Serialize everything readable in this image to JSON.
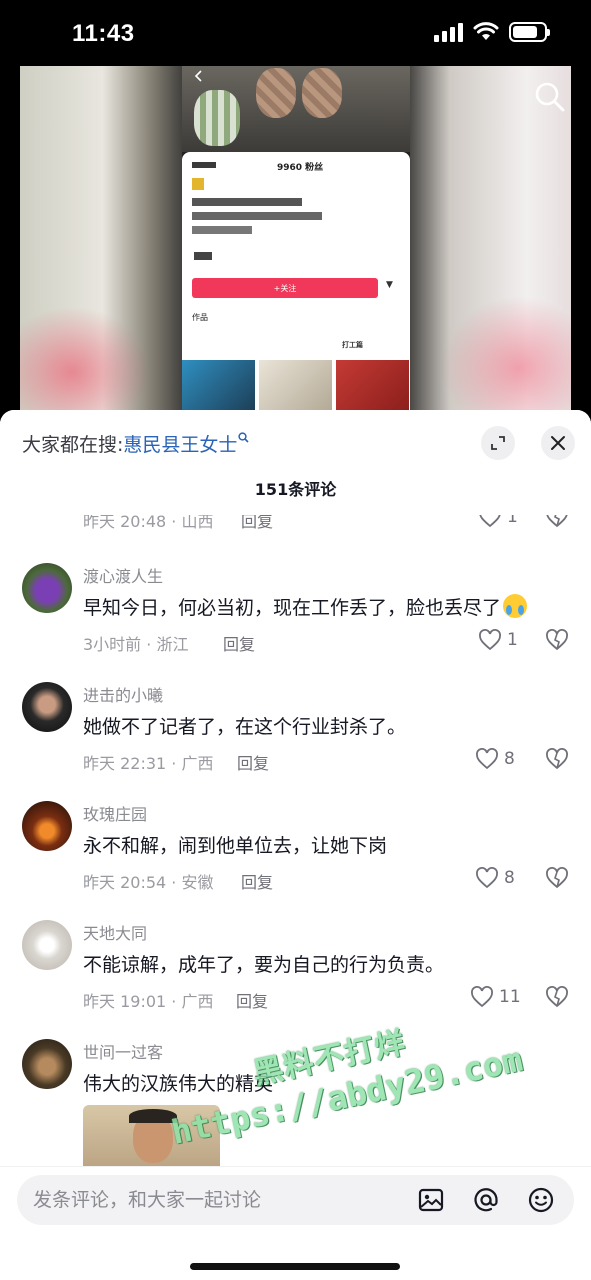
{
  "status_bar": {
    "time": "11:43"
  },
  "comment_panel": {
    "search_prefix": "大家都在搜:",
    "search_term": "惠民县王女士",
    "count_label": "151条评论"
  },
  "video_overlay": {
    "follower_stat": "9960 粉丝",
    "follow_label": "+关注",
    "works_label": "作品",
    "tab_label": "打工篇"
  },
  "partial_comment": {
    "meta": "昨天 20:48 · 山西",
    "reply": "回复",
    "likes": "1"
  },
  "comments": [
    {
      "name": "渡心渡人生",
      "text": "早知今日，何必当初，现在工作丢了，脸也丢尽了",
      "meta": "3小时前 · 浙江",
      "reply": "回复",
      "likes": "1"
    },
    {
      "name": "进击的小曦",
      "text": "她做不了记者了，在这个行业封杀了。",
      "meta": "昨天 22:31 · 广西",
      "reply": "回复",
      "likes": "8"
    },
    {
      "name": "玫瑰庄园",
      "text": "永不和解，闹到他单位去，让她下岗",
      "meta": "昨天 20:54 · 安徽",
      "reply": "回复",
      "likes": "8"
    },
    {
      "name": "天地大同",
      "text": "不能谅解，成年了，要为自己的行为负责。",
      "meta": "昨天 19:01 · 广西",
      "reply": "回复",
      "likes": "11"
    },
    {
      "name": "世间一过客",
      "text": "伟大的汉族伟大的精英"
    }
  ],
  "input_bar": {
    "placeholder": "发条评论，和大家一起讨论"
  },
  "watermark": {
    "line1": "黑料不打烊",
    "line2": "https://abdy29.com"
  },
  "colors": {
    "accent_link": "#2a63b8",
    "follow_button": "#f2385a",
    "watermark": "#8ee3a8"
  }
}
